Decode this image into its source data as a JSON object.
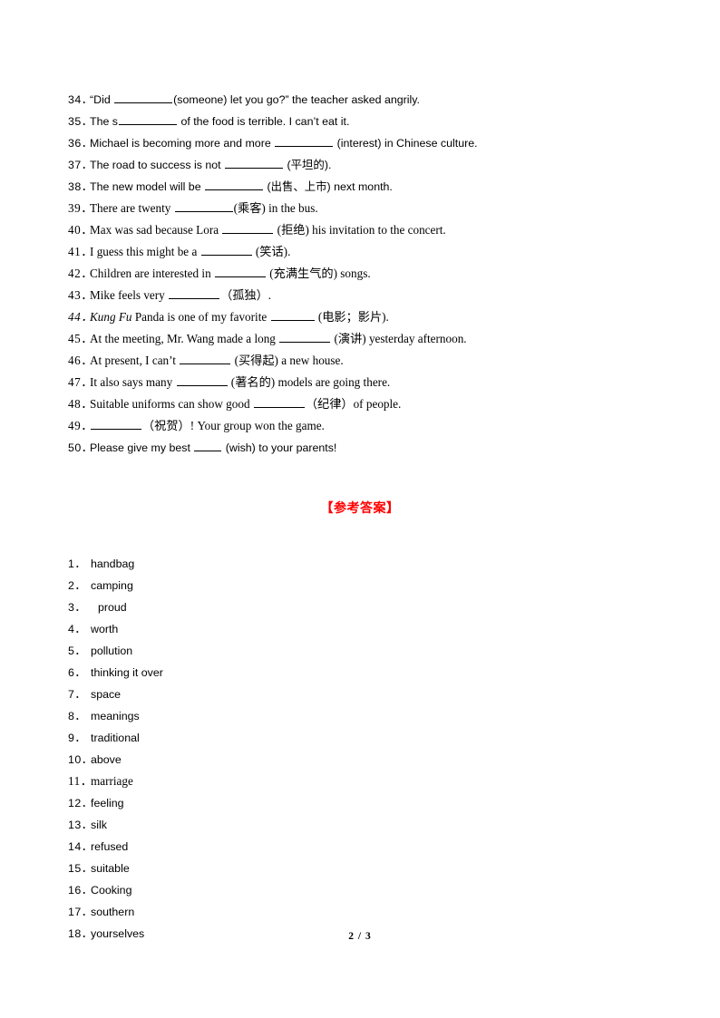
{
  "page": {
    "footer": "2 / 3"
  },
  "questions": [
    {
      "num": "34．",
      "style": "sans",
      "segments": [
        {
          "t": "text",
          "v": "“Did "
        },
        {
          "t": "blank",
          "w": "b-lg"
        },
        {
          "t": "text",
          "v": "(someone) let you go?” the teacher asked angrily."
        }
      ]
    },
    {
      "num": "35．",
      "style": "sans",
      "segments": [
        {
          "t": "text",
          "v": "The s"
        },
        {
          "t": "blank",
          "w": "b-lg"
        },
        {
          "t": "text",
          "v": " of the food is terrible. I can’t eat it."
        }
      ]
    },
    {
      "num": "36．",
      "style": "sans",
      "segments": [
        {
          "t": "text",
          "v": "Michael is becoming more and more "
        },
        {
          "t": "blank",
          "w": "b-lg"
        },
        {
          "t": "text",
          "v": " (interest) in Chinese culture."
        }
      ]
    },
    {
      "num": "37．",
      "style": "sans",
      "segments": [
        {
          "t": "text",
          "v": "The road to success is not "
        },
        {
          "t": "blank",
          "w": "b-lg"
        },
        {
          "t": "text",
          "v": " (平坦的)."
        }
      ]
    },
    {
      "num": "38．",
      "style": "sans",
      "segments": [
        {
          "t": "text",
          "v": "The new model will be "
        },
        {
          "t": "blank",
          "w": "b-lg"
        },
        {
          "t": "text",
          "v": " (出售、上市) next month."
        }
      ]
    },
    {
      "num": "39．",
      "style": "serif",
      "segments": [
        {
          "t": "text",
          "v": "There are twenty "
        },
        {
          "t": "blank",
          "w": "b-lg"
        },
        {
          "t": "text",
          "v": "(乘客) in the bus."
        }
      ]
    },
    {
      "num": "40．",
      "style": "serif",
      "segments": [
        {
          "t": "text",
          "v": "Max was sad because Lora "
        },
        {
          "t": "blank",
          "w": "b-md"
        },
        {
          "t": "text",
          "v": " (拒绝) his invitation to the concert."
        }
      ]
    },
    {
      "num": "41．",
      "style": "serif",
      "segments": [
        {
          "t": "text",
          "v": "I guess this might be a "
        },
        {
          "t": "blank",
          "w": "b-md"
        },
        {
          "t": "text",
          "v": " (笑话)."
        }
      ]
    },
    {
      "num": "42．",
      "style": "serif",
      "segments": [
        {
          "t": "text",
          "v": "Children are interested in "
        },
        {
          "t": "blank",
          "w": "b-md"
        },
        {
          "t": "text",
          "v": " (充满生气的) songs."
        }
      ]
    },
    {
      "num": "43．",
      "style": "serif",
      "segments": [
        {
          "t": "text",
          "v": "Mike feels very  "
        },
        {
          "t": "blank",
          "w": "b-md"
        },
        {
          "t": "text",
          "v": "（孤独）."
        }
      ]
    },
    {
      "num": "44．",
      "style": "serif italic",
      "segments": [
        {
          "t": "text",
          "v": "Kung Fu"
        },
        {
          "t": "roman",
          "v": " Panda is one of my favorite "
        },
        {
          "t": "blank",
          "w": "b-sm"
        },
        {
          "t": "roman",
          "v": " (电影；影片)."
        }
      ]
    },
    {
      "num": "45．",
      "style": "serif",
      "segments": [
        {
          "t": "text",
          "v": "At the meeting, Mr. Wang made a long "
        },
        {
          "t": "blank",
          "w": "b-md"
        },
        {
          "t": "text",
          "v": " (演讲) yesterday afternoon."
        }
      ]
    },
    {
      "num": "46．",
      "style": "serif",
      "segments": [
        {
          "t": "text",
          "v": "At present, I can’t "
        },
        {
          "t": "blank",
          "w": "b-md"
        },
        {
          "t": "text",
          "v": " (买得起) a new house."
        }
      ]
    },
    {
      "num": "47．",
      "style": "serif",
      "segments": [
        {
          "t": "text",
          "v": "It also says many "
        },
        {
          "t": "blank",
          "w": "b-md"
        },
        {
          "t": "text",
          "v": " (著名的) models are going there."
        }
      ]
    },
    {
      "num": "48．",
      "style": "serif",
      "segments": [
        {
          "t": "text",
          "v": "Suitable uniforms can show good "
        },
        {
          "t": "blank",
          "w": "b-md"
        },
        {
          "t": "text",
          "v": "（纪律）of people."
        }
      ]
    },
    {
      "num": "49．",
      "style": "serif",
      "segments": [
        {
          "t": "text",
          "v": " "
        },
        {
          "t": "blank",
          "w": "b-md"
        },
        {
          "t": "text",
          "v": "（祝贺）! Your group won the game."
        }
      ]
    },
    {
      "num": "50．",
      "style": "sans",
      "segments": [
        {
          "t": "text",
          "v": "Please give my best "
        },
        {
          "t": "blank",
          "w": "b-xs"
        },
        {
          "t": "text",
          "v": " (wish) to your parents!"
        }
      ]
    }
  ],
  "answer_key": {
    "heading": "【参考答案】",
    "heading_color": "#ff0000",
    "items": [
      {
        "num": "1．",
        "answer": "handbag",
        "style": "sans",
        "indent": false
      },
      {
        "num": "2．",
        "answer": "camping",
        "style": "sans",
        "indent": false
      },
      {
        "num": "3．",
        "answer": "proud",
        "style": "sans",
        "indent": true
      },
      {
        "num": "4．",
        "answer": "worth",
        "style": "sans",
        "indent": false
      },
      {
        "num": "5．",
        "answer": "pollution",
        "style": "sans",
        "indent": false
      },
      {
        "num": "6．",
        "answer": "thinking it over",
        "style": "sans",
        "indent": false
      },
      {
        "num": "7．",
        "answer": "space",
        "style": "sans",
        "indent": false
      },
      {
        "num": "8．",
        "answer": "meanings",
        "style": "sans",
        "indent": false
      },
      {
        "num": "9．",
        "answer": "traditional",
        "style": "sans",
        "indent": false
      },
      {
        "num": "10．",
        "answer": "above",
        "style": "sans",
        "indent": false
      },
      {
        "num": "11．",
        "answer": "marriage",
        "style": "serif",
        "indent": false
      },
      {
        "num": "12．",
        "answer": "feeling",
        "style": "sans",
        "indent": false
      },
      {
        "num": "13．",
        "answer": "silk",
        "style": "sans",
        "indent": false
      },
      {
        "num": "14．",
        "answer": "refused",
        "style": "sans",
        "indent": false
      },
      {
        "num": "15．",
        "answer": "suitable",
        "style": "sans",
        "indent": false
      },
      {
        "num": "16．",
        "answer": "Cooking",
        "style": "sans",
        "indent": false
      },
      {
        "num": "17．",
        "answer": "southern",
        "style": "sans",
        "indent": false
      },
      {
        "num": "18．",
        "answer": "yourselves",
        "style": "sans",
        "indent": false
      }
    ]
  }
}
